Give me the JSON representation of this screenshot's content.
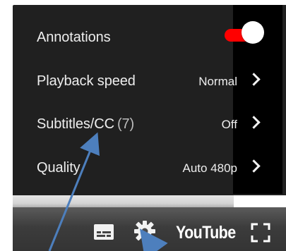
{
  "settings_menu": {
    "items": [
      {
        "label": "Annotations",
        "type": "toggle",
        "toggle_on": true
      },
      {
        "label": "Playback speed",
        "value": "Normal"
      },
      {
        "label": "Subtitles/CC",
        "count": "(7)",
        "value": "Off"
      },
      {
        "label": "Quality",
        "value": "Auto 480p"
      }
    ]
  },
  "player_controls": {
    "logo_text": "YouTube",
    "icons": [
      "subtitles-icon",
      "settings-gear-icon",
      "fullscreen-icon"
    ]
  },
  "colors": {
    "toggle_track": "#ff0000",
    "arrow": "#4d7fbd"
  }
}
